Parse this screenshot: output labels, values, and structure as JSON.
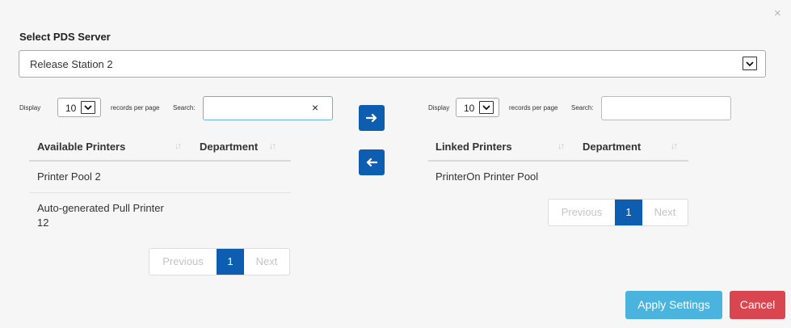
{
  "dialog": {
    "close_glyph": "×",
    "title": "Select PDS Server",
    "server_select": {
      "value": "Release Station 2"
    }
  },
  "left_panel": {
    "display_label": "Display",
    "page_size": "10",
    "records_label": "records per page",
    "search_label": "Search:",
    "search_value": "",
    "search_clear": "×",
    "columns": [
      "Available Printers",
      "Department"
    ],
    "rows": [
      {
        "printer": "Printer Pool 2",
        "department": ""
      },
      {
        "printer_line1": "Auto-generated Pull Printer",
        "printer_line2": "12",
        "department": ""
      }
    ],
    "pagination": {
      "previous": "Previous",
      "current": "1",
      "next": "Next"
    }
  },
  "transfer": {
    "add_icon": "arrow-right-icon",
    "remove_icon": "arrow-left-icon"
  },
  "right_panel": {
    "display_label": "Display",
    "page_size": "10",
    "records_label": "records per page",
    "search_label": "Search:",
    "search_value": "",
    "columns": [
      "Linked Printers",
      "Department"
    ],
    "rows": [
      {
        "printer": "PrinterOn Printer Pool",
        "department": ""
      }
    ],
    "pagination": {
      "previous": "Previous",
      "current": "1",
      "next": "Next"
    }
  },
  "footer": {
    "apply_label": "Apply Settings",
    "cancel_label": "Cancel"
  },
  "colors": {
    "primary": "#0d5eb0",
    "apply": "#4ab3de",
    "cancel": "#d94650"
  }
}
